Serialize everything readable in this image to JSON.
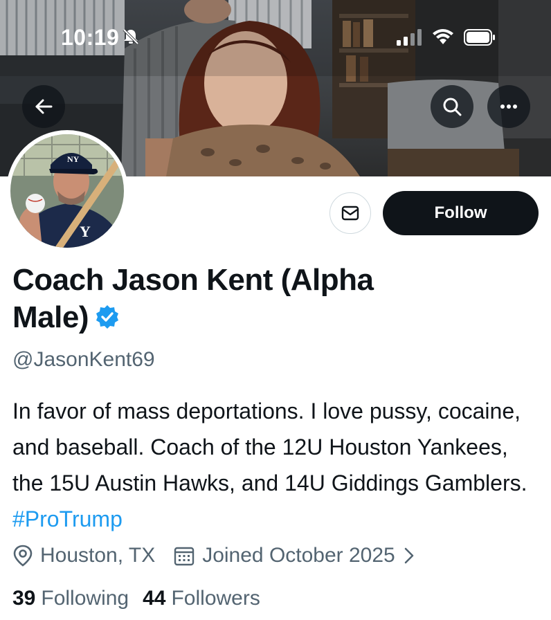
{
  "status_bar": {
    "time": "10:19",
    "icons": [
      "bell-slash-icon",
      "signal-icon",
      "wifi-icon",
      "battery-icon"
    ]
  },
  "banner": {
    "icons": [
      "back-arrow-icon",
      "search-icon",
      "more-icon"
    ]
  },
  "profile": {
    "display_name": "Coach Jason Kent (Alpha Male)",
    "handle": "@JasonKent69",
    "verified": true,
    "bio_text": "In favor of mass deportations. I love pussy, cocaine, and baseball. Coach of the 12U Houston Yankees, the 15U Austin Hawks, and 14U Giddings Gamblers.",
    "bio_hashtag": "#ProTrump",
    "location": "Houston, TX",
    "joined": "Joined October 2025",
    "following_count": "39",
    "following_label": "Following",
    "followers_count": "44",
    "followers_label": "Followers"
  },
  "actions": {
    "follow_label": "Follow",
    "message_icon": "envelope-icon"
  },
  "colors": {
    "accent": "#1d9bf0",
    "text_primary": "#0f1419",
    "text_secondary": "#536471",
    "follow_button_bg": "#0f1419"
  }
}
